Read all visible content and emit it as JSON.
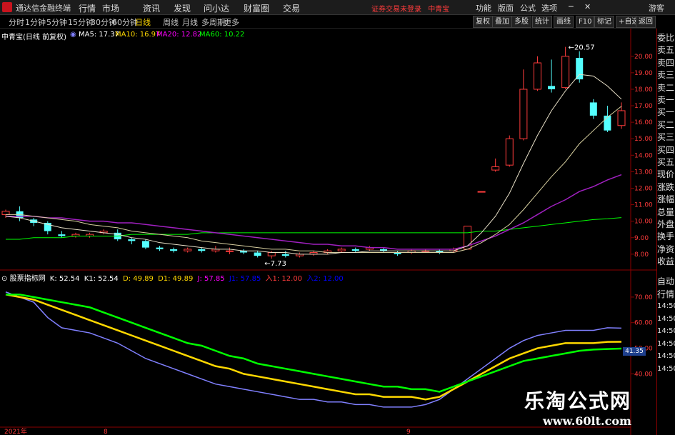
{
  "app": {
    "title": "通达信金融终端",
    "notice": "证券交易未登录",
    "stock_short": "中青宝"
  },
  "menu": [
    "行情",
    "市场",
    "资讯",
    "发现",
    "问小达",
    "财富圈",
    "交易"
  ],
  "right_menu": [
    "功能",
    "版面",
    "公式",
    "选项"
  ],
  "right_extra": "游客",
  "period_tabs": [
    "分时",
    "1分钟",
    "5分钟",
    "15分钟",
    "30分钟",
    "60分钟",
    "日线",
    "周线",
    "月线",
    "多周期",
    "更多"
  ],
  "active_tab": "日线",
  "right_buttons": [
    "复权",
    "叠加",
    "多股",
    "统计",
    "画线",
    "F10",
    "标记",
    "+自选",
    "返回"
  ],
  "main_info": {
    "stock": "中青宝(日线 前复权)",
    "ma5": "MA5: 17.37",
    "ma10": "MA10: 16.97",
    "ma20": "MA20: 12.82",
    "ma60": "MA60: 10.22"
  },
  "sub_info": {
    "name": "股票指标网",
    "k": "K: 52.54",
    "k1": "K1: 52.54",
    "d": "D: 49.89",
    "d1": "D1: 49.89",
    "j": "J: 57.85",
    "extra1": "J1: 57.85",
    "extra2": "入1: 12.00",
    "extra3": "入2: 12.00"
  },
  "price_axis": [
    "20.00",
    "19.00",
    "18.00",
    "17.00",
    "16.00",
    "15.00",
    "14.00",
    "13.00",
    "12.00",
    "11.00",
    "10.00",
    "9.00",
    "8.00"
  ],
  "osc_axis": [
    "70.00",
    "60.00",
    "50.00",
    "40.00"
  ],
  "osc_badge": "41.35",
  "annotations": {
    "high": "20.57",
    "low": "7.73"
  },
  "x_labels": [
    "2021年",
    "8",
    "9"
  ],
  "sidebar_top": [
    "委比",
    "卖五",
    "卖四",
    "卖三",
    "卖二",
    "卖一",
    "买一",
    "买二",
    "买三",
    "买四",
    "买五",
    "现价",
    "涨跌",
    "涨幅",
    "总量",
    "外盘",
    "换手",
    "净资",
    "收益"
  ],
  "sidebar_bottom": [
    "自动",
    "行情",
    "14:50",
    "14:50",
    "14:50",
    "14:50",
    "14:50",
    "14:50"
  ],
  "watermark": {
    "line1": "乐淘公式网",
    "line2": "www.60lt.com"
  },
  "colors": {
    "up": "#ff3c3c",
    "down": "#54ffff",
    "ma5": "#ffffff",
    "ma10": "#ffd800",
    "ma20": "#ff00ff",
    "ma60": "#00ff00",
    "k": "#8080ff",
    "d": "#ffd800",
    "j": "#00ff00"
  },
  "chart_data": {
    "type": "candlestick",
    "price_range": [
      7.3,
      20.9
    ],
    "candles": [
      [
        10.4,
        10.6,
        10.7,
        10.2
      ],
      [
        10.6,
        10.2,
        10.9,
        10.0
      ],
      [
        10.1,
        9.9,
        10.2,
        9.7
      ],
      [
        9.9,
        9.4,
        10.0,
        9.2
      ],
      [
        9.2,
        9.1,
        9.4,
        9.0
      ],
      [
        9.1,
        9.2,
        9.3,
        9.0
      ],
      [
        9.1,
        9.2,
        9.3,
        9.0
      ],
      [
        9.3,
        9.4,
        9.5,
        9.2
      ],
      [
        9.3,
        8.9,
        9.5,
        8.8
      ],
      [
        8.9,
        8.8,
        9.0,
        8.6
      ],
      [
        8.8,
        8.4,
        8.9,
        8.3
      ],
      [
        8.4,
        8.3,
        8.5,
        8.2
      ],
      [
        8.3,
        8.2,
        8.4,
        8.1
      ],
      [
        8.2,
        8.3,
        8.4,
        8.1
      ],
      [
        8.3,
        8.2,
        8.4,
        8.1
      ],
      [
        8.2,
        8.3,
        8.5,
        8.1
      ],
      [
        8.2,
        8.2,
        8.4,
        8.0
      ],
      [
        8.2,
        8.1,
        8.3,
        8.0
      ],
      [
        8.1,
        7.9,
        8.2,
        7.8
      ],
      [
        7.9,
        8.1,
        8.2,
        7.73
      ],
      [
        8.0,
        7.9,
        8.2,
        7.8
      ],
      [
        7.9,
        8.0,
        8.1,
        7.8
      ],
      [
        8.0,
        8.1,
        8.2,
        7.9
      ],
      [
        8.1,
        8.2,
        8.3,
        8.0
      ],
      [
        8.2,
        8.3,
        8.4,
        8.1
      ],
      [
        8.3,
        8.2,
        8.4,
        8.1
      ],
      [
        8.3,
        8.4,
        8.5,
        8.2
      ],
      [
        8.3,
        8.2,
        8.4,
        8.1
      ],
      [
        8.1,
        8.0,
        8.2,
        7.9
      ],
      [
        8.1,
        8.2,
        8.3,
        8.0
      ],
      [
        8.2,
        8.2,
        8.3,
        8.1
      ],
      [
        8.2,
        8.1,
        8.3,
        8.0
      ],
      [
        8.2,
        8.3,
        8.4,
        8.1
      ],
      [
        8.3,
        9.7,
        9.7,
        8.3
      ],
      [
        11.8,
        11.8,
        11.8,
        11.8
      ],
      [
        13.1,
        13.3,
        13.8,
        13.0
      ],
      [
        13.4,
        15.0,
        15.2,
        13.3
      ],
      [
        15.0,
        18.0,
        19.2,
        14.9
      ],
      [
        18.0,
        19.6,
        20.0,
        17.9
      ],
      [
        18.2,
        18.0,
        19.8,
        17.8
      ],
      [
        18.1,
        20.0,
        20.57,
        18.0
      ],
      [
        19.9,
        18.6,
        20.3,
        18.4
      ],
      [
        17.2,
        16.4,
        17.4,
        16.2
      ],
      [
        16.4,
        15.5,
        17.0,
        15.4
      ],
      [
        15.8,
        16.7,
        17.2,
        15.6
      ]
    ],
    "ma5": [
      10.3,
      10.2,
      10.0,
      9.8,
      9.6,
      9.5,
      9.4,
      9.3,
      9.2,
      9.0,
      8.9,
      8.7,
      8.6,
      8.5,
      8.4,
      8.3,
      8.3,
      8.2,
      8.2,
      8.1,
      8.1,
      8.0,
      8.0,
      8.0,
      8.1,
      8.1,
      8.2,
      8.2,
      8.2,
      8.2,
      8.2,
      8.2,
      8.2,
      8.5,
      9.3,
      10.3,
      11.7,
      13.5,
      15.2,
      16.7,
      17.9,
      18.9,
      18.8,
      18.2,
      17.4
    ],
    "ma10": [
      10.4,
      10.4,
      10.3,
      10.2,
      10.1,
      10.0,
      9.8,
      9.7,
      9.6,
      9.4,
      9.3,
      9.2,
      9.1,
      9.0,
      8.8,
      8.7,
      8.6,
      8.5,
      8.4,
      8.3,
      8.3,
      8.2,
      8.2,
      8.1,
      8.1,
      8.1,
      8.1,
      8.1,
      8.1,
      8.1,
      8.1,
      8.1,
      8.1,
      8.3,
      8.7,
      9.2,
      9.8,
      10.7,
      11.7,
      12.7,
      13.6,
      14.7,
      15.5,
      16.3,
      16.97
    ],
    "ma20": [
      10.3,
      10.3,
      10.3,
      10.2,
      10.2,
      10.1,
      10.0,
      10.0,
      9.9,
      9.9,
      9.8,
      9.7,
      9.6,
      9.5,
      9.4,
      9.3,
      9.2,
      9.1,
      9.0,
      8.9,
      8.8,
      8.7,
      8.6,
      8.6,
      8.5,
      8.5,
      8.4,
      8.4,
      8.3,
      8.3,
      8.3,
      8.3,
      8.3,
      8.5,
      8.8,
      9.1,
      9.5,
      9.9,
      10.4,
      10.9,
      11.3,
      11.8,
      12.1,
      12.5,
      12.82
    ],
    "ma60": [
      8.9,
      8.9,
      9.0,
      9.0,
      9.0,
      9.1,
      9.1,
      9.1,
      9.1,
      9.2,
      9.2,
      9.2,
      9.2,
      9.2,
      9.3,
      9.3,
      9.3,
      9.3,
      9.3,
      9.3,
      9.3,
      9.3,
      9.3,
      9.3,
      9.3,
      9.3,
      9.3,
      9.3,
      9.3,
      9.3,
      9.3,
      9.3,
      9.3,
      9.3,
      9.4,
      9.4,
      9.5,
      9.6,
      9.7,
      9.8,
      9.9,
      10.0,
      10.1,
      10.15,
      10.22
    ],
    "osc_range": [
      20,
      75
    ],
    "k": [
      72,
      70,
      68,
      62,
      58,
      57,
      56,
      54,
      52,
      49,
      46,
      44,
      42,
      40,
      38,
      36,
      35,
      34,
      33,
      32,
      31,
      30,
      30,
      29,
      29,
      28,
      28,
      27,
      27,
      27,
      28,
      30,
      34,
      38,
      42,
      46,
      50,
      53,
      55,
      56,
      57,
      57,
      57,
      58,
      57.85
    ],
    "d": [
      71,
      70,
      69,
      67,
      65,
      63,
      61,
      59,
      57,
      55,
      53,
      51,
      49,
      47,
      45,
      43,
      42,
      40,
      39,
      38,
      37,
      36,
      35,
      34,
      33,
      32,
      32,
      31,
      31,
      31,
      30,
      31,
      34,
      37,
      40,
      43,
      46,
      48,
      50,
      51,
      52,
      52,
      52,
      52.5,
      52.54
    ],
    "j": [
      71,
      71,
      70,
      69,
      68,
      67,
      66,
      64,
      62,
      60,
      58,
      56,
      54,
      52,
      51,
      49,
      47,
      46,
      44,
      43,
      42,
      41,
      40,
      39,
      38,
      37,
      36,
      35,
      35,
      34,
      34,
      33,
      35,
      37,
      39,
      41,
      43,
      45,
      46,
      47,
      48,
      49,
      49.5,
      49.7,
      49.89
    ]
  }
}
